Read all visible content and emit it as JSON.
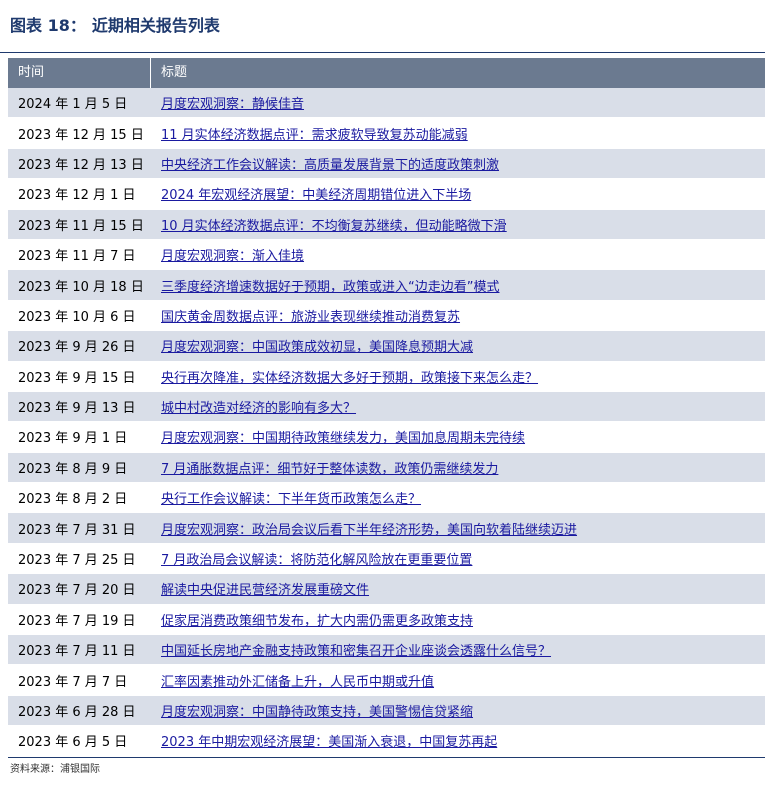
{
  "figure": {
    "label": "图表 18：",
    "title": "近期相关报告列表"
  },
  "table": {
    "headers": [
      "时间",
      "标题"
    ],
    "rows": [
      {
        "date": "2024 年 1 月 5 日",
        "title": "月度宏观洞察：静候佳音"
      },
      {
        "date": "2023 年 12 月 15 日",
        "title": "11 月实体经济数据点评：需求疲软导致复苏动能减弱"
      },
      {
        "date": "2023 年 12 月 13 日",
        "title": "中央经济工作会议解读：高质量发展背景下的适度政策刺激"
      },
      {
        "date": "2023 年 12 月 1 日",
        "title": "2024 年宏观经济展望：中美经济周期错位进入下半场"
      },
      {
        "date": "2023 年 11 月 15 日",
        "title": "10 月实体经济数据点评：不均衡复苏继续，但动能略微下滑"
      },
      {
        "date": "2023 年 11 月 7 日",
        "title": "月度宏观洞察：渐入佳境"
      },
      {
        "date": "2023 年 10 月 18 日",
        "title": "三季度经济增速数据好于预期，政策或进入“边走边看”模式"
      },
      {
        "date": "2023 年 10 月 6 日",
        "title": "国庆黄金周数据点评：旅游业表现继续推动消费复苏"
      },
      {
        "date": "2023 年 9 月 26 日",
        "title": "月度宏观洞察：中国政策成效初显，美国降息预期大减"
      },
      {
        "date": "2023 年 9 月 15 日",
        "title": "央行再次降准，实体经济数据大多好于预期，政策接下来怎么走？"
      },
      {
        "date": "2023 年 9 月 13 日",
        "title": "城中村改造对经济的影响有多大？"
      },
      {
        "date": "2023 年 9 月 1 日",
        "title": "月度宏观洞察：中国期待政策继续发力，美国加息周期未完待续"
      },
      {
        "date": "2023 年 8 月 9 日",
        "title": "7 月通胀数据点评：细节好于整体读数，政策仍需继续发力"
      },
      {
        "date": "2023 年 8 月 2 日",
        "title": "央行工作会议解读：下半年货币政策怎么走？"
      },
      {
        "date": "2023 年 7 月 31 日",
        "title": "月度宏观洞察：政治局会议后看下半年经济形势，美国向软着陆继续迈进"
      },
      {
        "date": "2023 年 7 月 25 日",
        "title": "7 月政治局会议解读：将防范化解风险放在更重要位置"
      },
      {
        "date": "2023 年 7 月 20 日",
        "title": "解读中央促进民营经济发展重磅文件"
      },
      {
        "date": "2023 年 7 月 19 日",
        "title": "促家居消费政策细节发布，扩大内需仍需更多政策支持"
      },
      {
        "date": "2023 年 7 月 11 日",
        "title": "中国延长房地产金融支持政策和密集召开企业座谈会透露什么信号？"
      },
      {
        "date": "2023 年 7 月 7 日",
        "title": "汇率因素推动外汇储备上升，人民币中期或升值"
      },
      {
        "date": "2023 年 6 月 28 日",
        "title": "月度宏观洞察：中国静待政策支持，美国警惕信贷紧缩"
      },
      {
        "date": "2023 年 6 月 5 日",
        "title": "2023 年中期宏观经济展望：美国渐入衰退，中国复苏再起"
      }
    ]
  },
  "source": "资料来源：浦银国际",
  "colors": {
    "header_bg": "#6b7a90",
    "row_shade": "#d9dee8",
    "link": "#1a1aa0",
    "title": "#1f3a6e"
  }
}
